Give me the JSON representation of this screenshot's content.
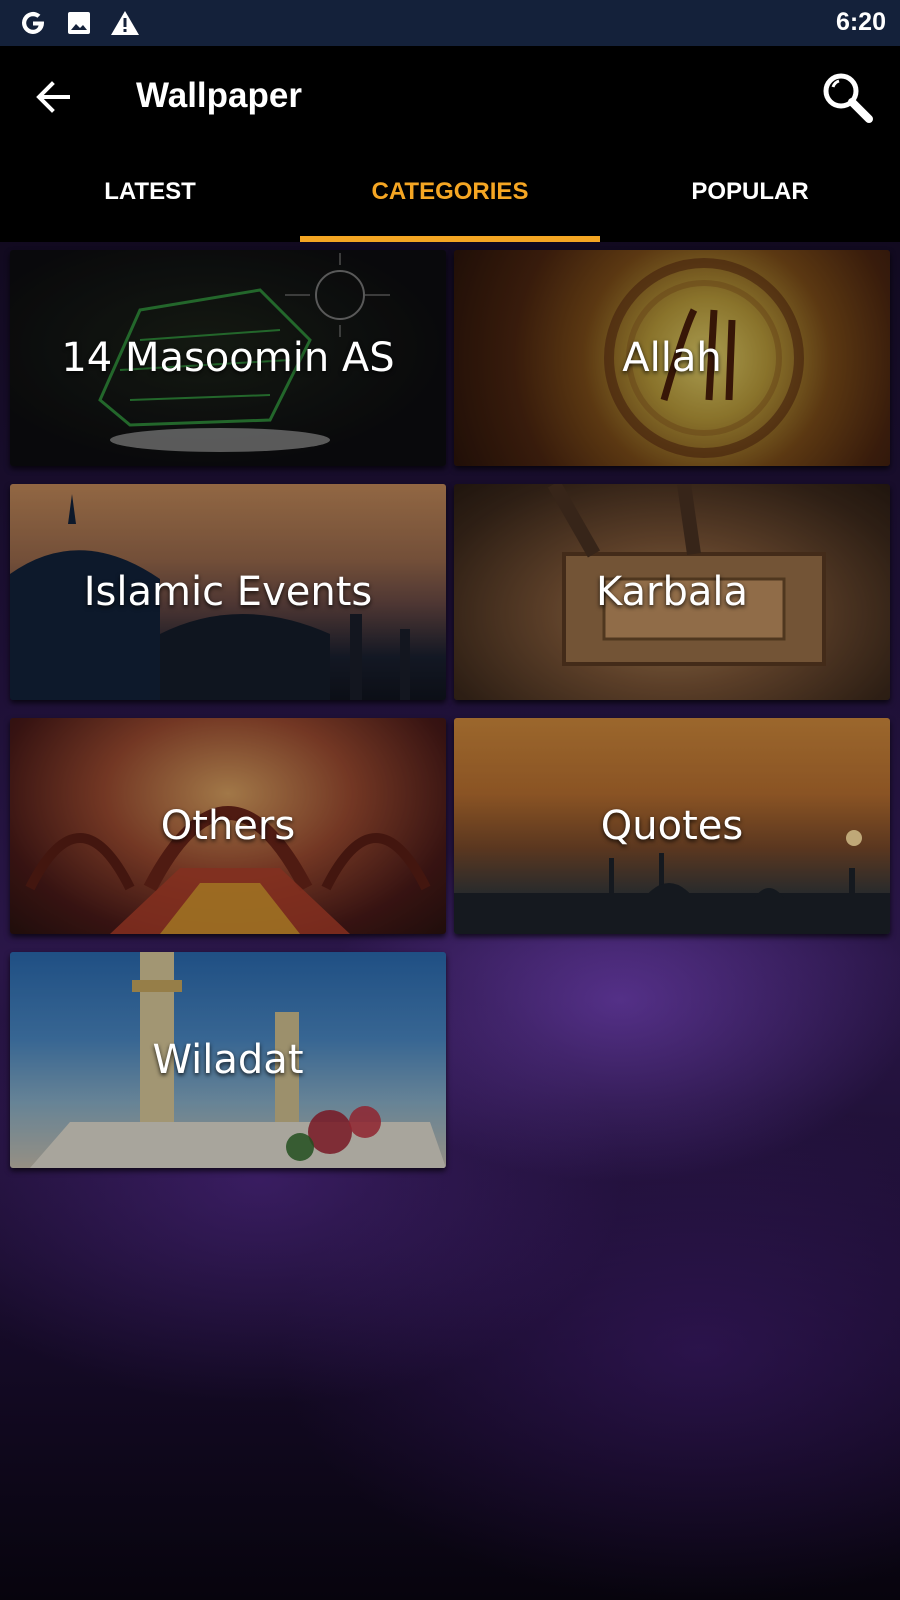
{
  "status_bar": {
    "time": "6:20",
    "left_icons": [
      "google-icon",
      "image-icon",
      "warning-icon"
    ]
  },
  "app_bar": {
    "title": "Wallpaper",
    "back_icon": "arrow-left-icon",
    "search_icon": "search-icon"
  },
  "tabs": [
    {
      "label": "LATEST",
      "active": false
    },
    {
      "label": "CATEGORIES",
      "active": true
    },
    {
      "label": "POPULAR",
      "active": false
    }
  ],
  "categories": [
    {
      "label": "14 Masoomin AS"
    },
    {
      "label": "Allah"
    },
    {
      "label": "Islamic Events"
    },
    {
      "label": "Karbala"
    },
    {
      "label": "Others"
    },
    {
      "label": "Quotes"
    },
    {
      "label": "Wiladat"
    }
  ],
  "colors": {
    "accent": "#f5a623",
    "status_bar": "#14213a",
    "app_bar": "#000000"
  }
}
